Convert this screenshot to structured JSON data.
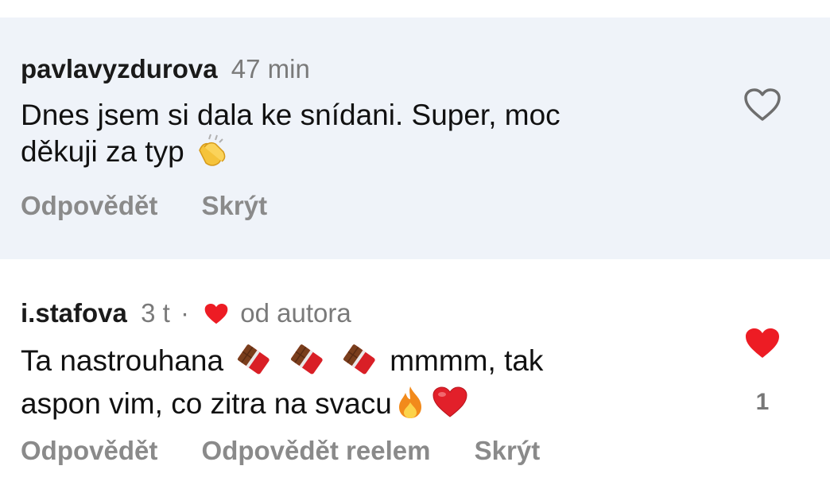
{
  "comments": [
    {
      "username": "pavlavyzdurova",
      "time": "47 min",
      "text_line1": "Dnes jsem si dala ke snídani. Super, moc",
      "text_line2": "děkuji za typ",
      "emojis": [
        "clapping-hands"
      ],
      "actions": [
        "Odpovědět",
        "Skrýt"
      ],
      "liked": false
    },
    {
      "username": "i.stafova",
      "time": "3 t",
      "separator": "·",
      "author_like_label": "od autora",
      "text_part1": "Ta nastrouhana",
      "text_part2": "mmmm, tak",
      "text_line2": "aspon vim, co zitra na svacu",
      "emojis": [
        "chocolate-bar",
        "chocolate-bar",
        "chocolate-bar",
        "fire",
        "red-heart"
      ],
      "actions": [
        "Odpovědět",
        "Odpovědět reelem",
        "Skrýt"
      ],
      "liked": true,
      "like_count": "1"
    }
  ],
  "colors": {
    "highlight_bg": "#eff3f9",
    "like_red": "#ed1c24",
    "muted": "#8a8a8a"
  }
}
